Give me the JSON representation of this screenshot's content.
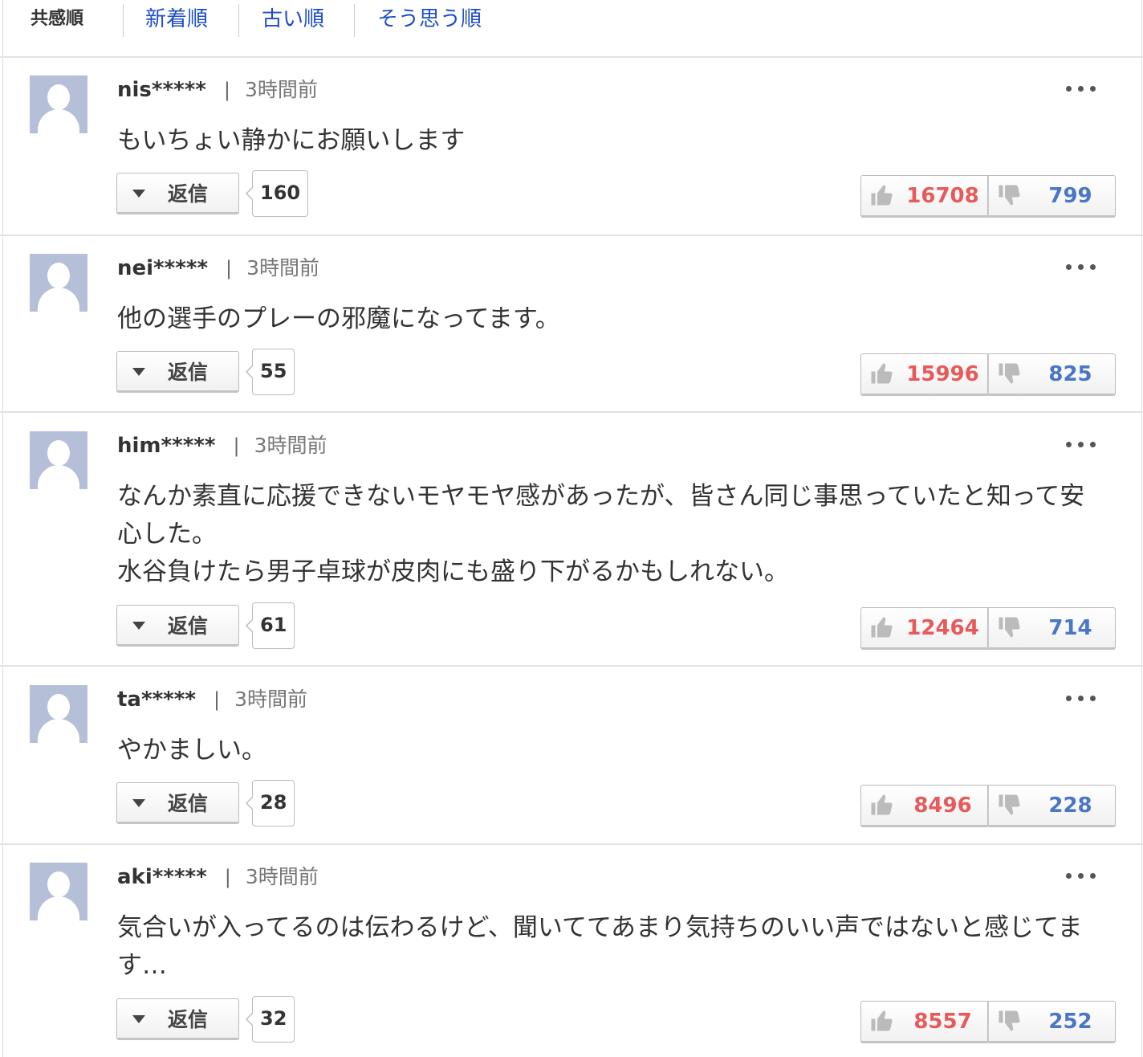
{
  "sort_tabs": [
    {
      "label": "共感順",
      "active": true
    },
    {
      "label": "新着順",
      "active": false
    },
    {
      "label": "古い順",
      "active": false
    },
    {
      "label": "そう思う順",
      "active": false
    }
  ],
  "reply_label": "返信",
  "colors": {
    "accent_link": "#1d4ec6",
    "agree": "#e75a5a",
    "disagree": "#4a76c6",
    "avatar": "#b5bfd7"
  },
  "comments": [
    {
      "user": "nis*****",
      "separator": "|",
      "time": "3時間前",
      "text": "もいちょい静かにお願いします",
      "replies": "160",
      "agree": "16708",
      "disagree": "799"
    },
    {
      "user": "nei*****",
      "separator": "|",
      "time": "3時間前",
      "text": "他の選手のプレーの邪魔になってます。",
      "replies": "55",
      "agree": "15996",
      "disagree": "825"
    },
    {
      "user": "him*****",
      "separator": "|",
      "time": "3時間前",
      "text": "なんか素直に応援できないモヤモヤ感があったが、皆さん同じ事思っていたと知って安心した。\n水谷負けたら男子卓球が皮肉にも盛り下がるかもしれない。",
      "replies": "61",
      "agree": "12464",
      "disagree": "714"
    },
    {
      "user": "ta*****",
      "separator": "|",
      "time": "3時間前",
      "text": "やかましい。",
      "replies": "28",
      "agree": "8496",
      "disagree": "228"
    },
    {
      "user": "aki*****",
      "separator": "|",
      "time": "3時間前",
      "text": "気合いが入ってるのは伝わるけど、聞いててあまり気持ちのいい声ではないと感じてます…",
      "replies": "32",
      "agree": "8557",
      "disagree": "252"
    }
  ]
}
